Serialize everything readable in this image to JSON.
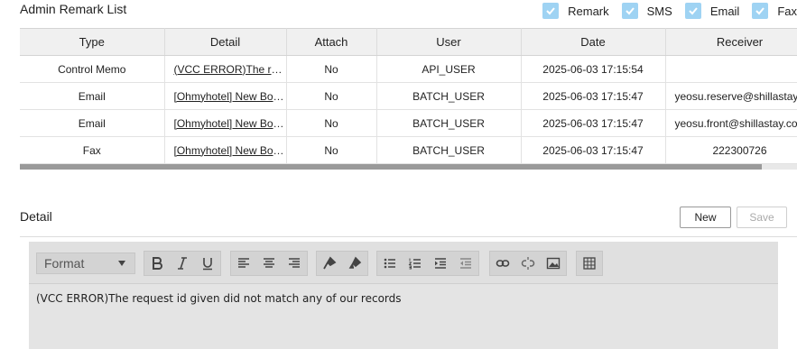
{
  "list": {
    "title": "Admin Remark List",
    "filters": [
      {
        "label": "Remark",
        "checked": true
      },
      {
        "label": "SMS",
        "checked": true
      },
      {
        "label": "Email",
        "checked": true
      },
      {
        "label": "Fax",
        "checked": true
      }
    ],
    "columns": [
      "Type",
      "Detail",
      "Attach",
      "User",
      "Date",
      "Receiver"
    ],
    "rows": [
      {
        "type": "Control Memo",
        "detail": "(VCC ERROR)The request id given did not match any of our records",
        "attach": "No",
        "user": "API_USER",
        "date": "2025-06-03 17:15:54",
        "receiver": ""
      },
      {
        "type": "Email",
        "detail": "[Ohmyhotel] New Booking Notification",
        "attach": "No",
        "user": "BATCH_USER",
        "date": "2025-06-03 17:15:47",
        "receiver": "yeosu.reserve@shillastay.com"
      },
      {
        "type": "Email",
        "detail": "[Ohmyhotel] New Booking Notification",
        "attach": "No",
        "user": "BATCH_USER",
        "date": "2025-06-03 17:15:47",
        "receiver": "yeosu.front@shillastay.com"
      },
      {
        "type": "Fax",
        "detail": "[Ohmyhotel] New Booking Notification",
        "attach": "No",
        "user": "BATCH_USER",
        "date": "2025-06-03 17:15:47",
        "receiver": "222300726"
      }
    ]
  },
  "detail": {
    "title": "Detail",
    "new_label": "New",
    "save_label": "Save",
    "format_label": "Format",
    "content": "(VCC ERROR)The request id given did not match any of our records"
  },
  "colors": {
    "checkbox": "#9fd3f3",
    "header_bg": "#f0f0f0",
    "editor_bg": "#e4e4e4"
  }
}
